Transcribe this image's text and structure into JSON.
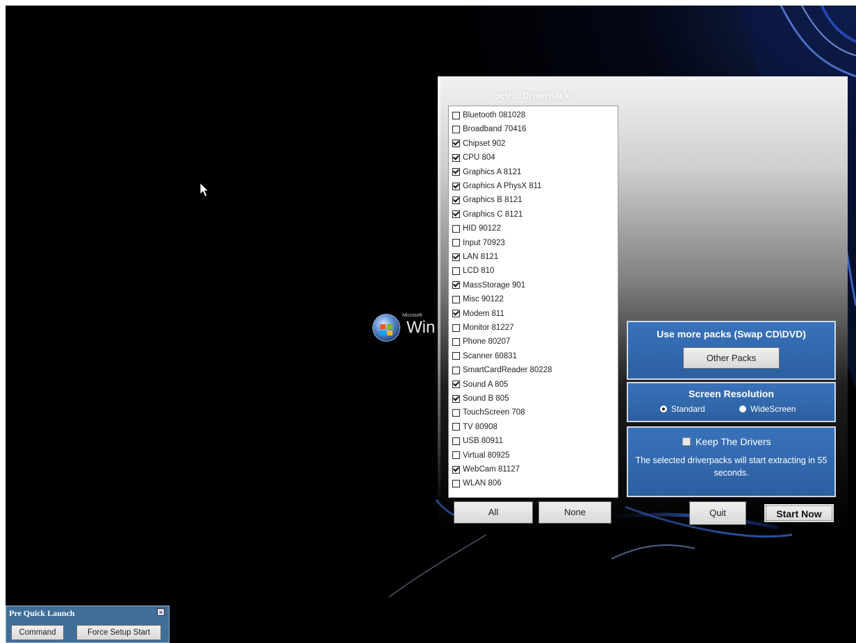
{
  "windows_logo": {
    "microsoft": "Microsoft",
    "word": "Win"
  },
  "driverpacks": {
    "title": "Select Driverpacks",
    "items": [
      {
        "label": "Bluetooth 081028",
        "checked": false
      },
      {
        "label": "Broadband 70416",
        "checked": false
      },
      {
        "label": "Chipset 902",
        "checked": true
      },
      {
        "label": "CPU 804",
        "checked": true
      },
      {
        "label": "Graphics A 8121",
        "checked": true
      },
      {
        "label": "Graphics A PhysX 811",
        "checked": true
      },
      {
        "label": "Graphics B 8121",
        "checked": true
      },
      {
        "label": "Graphics C 8121",
        "checked": true
      },
      {
        "label": "HID 90122",
        "checked": false
      },
      {
        "label": "Input 70923",
        "checked": false
      },
      {
        "label": "LAN 8121",
        "checked": true
      },
      {
        "label": "LCD 810",
        "checked": false
      },
      {
        "label": "MassStorage 901",
        "checked": true
      },
      {
        "label": "Misc 90122",
        "checked": false
      },
      {
        "label": "Modem 811",
        "checked": true
      },
      {
        "label": "Monitor 81227",
        "checked": false
      },
      {
        "label": "Phone 80207",
        "checked": false
      },
      {
        "label": "Scanner 60831",
        "checked": false
      },
      {
        "label": "SmartCardReader 80228",
        "checked": false
      },
      {
        "label": "Sound A 805",
        "checked": true
      },
      {
        "label": "Sound B 805",
        "checked": true
      },
      {
        "label": "TouchScreen 708",
        "checked": false
      },
      {
        "label": "TV 80908",
        "checked": false
      },
      {
        "label": "USB 80911",
        "checked": false
      },
      {
        "label": "Virtual 80925",
        "checked": false
      },
      {
        "label": "WebCam 81127",
        "checked": true
      },
      {
        "label": "WLAN 806",
        "checked": false
      }
    ]
  },
  "buttons": {
    "all": "All",
    "none": "None",
    "quit": "Quit",
    "start_now": "Start Now"
  },
  "more_packs": {
    "title": "Use more packs (Swap CD\\DVD)",
    "button": "Other Packs"
  },
  "resolution": {
    "title": "Screen Resolution",
    "standard": "Standard",
    "widescreen": "WideScreen",
    "selected": "standard"
  },
  "keep_drivers": {
    "label": "Keep The Drivers",
    "message": "The selected driverpacks will start extracting in 55 seconds."
  },
  "quick_launch": {
    "title": "Pre Quick Launch",
    "close": "×",
    "command": "Command",
    "force_setup": "Force Setup Start"
  },
  "colors": {
    "panel_blue": "#3470b6",
    "quick_launch_blue": "#3f6f99"
  }
}
